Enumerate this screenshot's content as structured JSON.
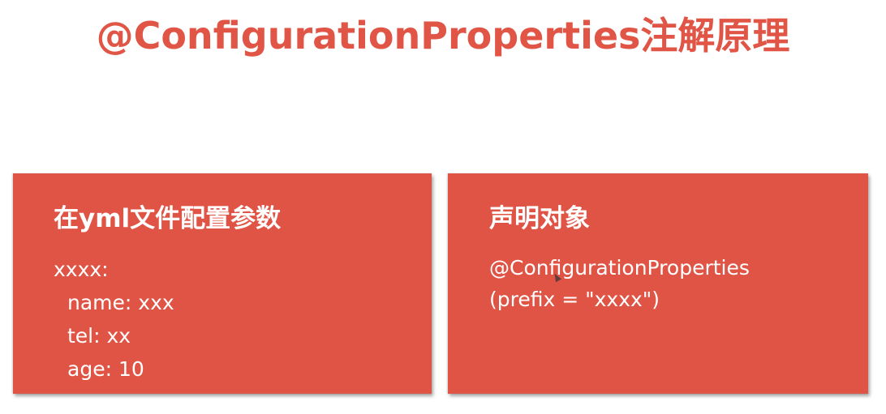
{
  "slide": {
    "title": "@ConfigurationProperties注解原理"
  },
  "left_card": {
    "heading": "在yml文件配置参数",
    "lines": [
      "xxxx:",
      "name: xxx",
      "tel: xx",
      "age: 10"
    ]
  },
  "right_card": {
    "heading": "声明对象",
    "lines": [
      "@ConfigurationProperties",
      "(prefix = \"xxxx\")"
    ]
  },
  "colors": {
    "accent": "#e05545",
    "card_background": "#e05446",
    "card_text": "#ffffff"
  },
  "icons": {
    "cursor": "mouse-pointer-icon"
  }
}
